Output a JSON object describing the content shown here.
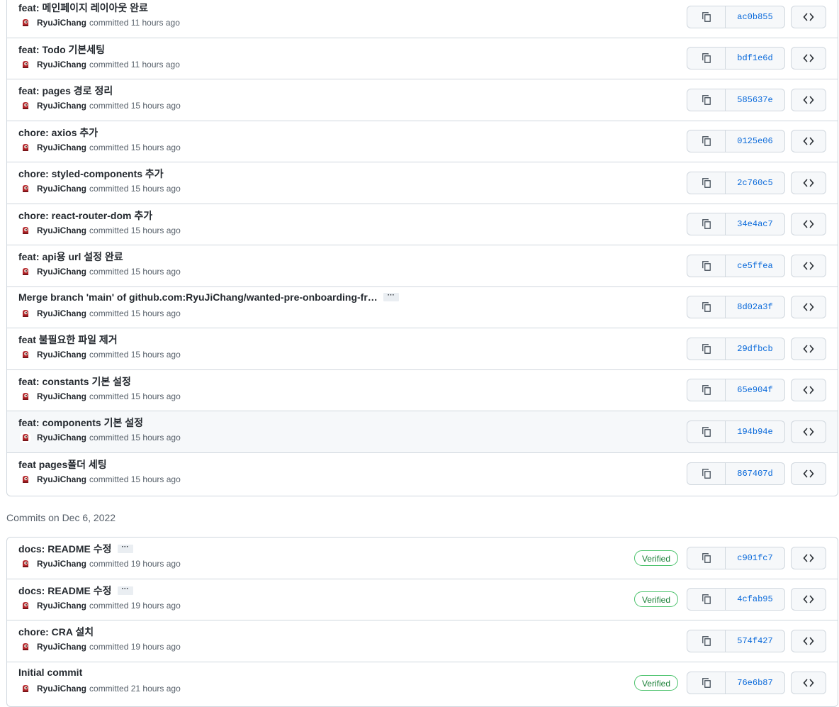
{
  "committed_label": "committed",
  "group_header": "Commits on Dec 6, 2022",
  "verified_label": "Verified",
  "colors": {
    "sha": "#0969da",
    "verified": "#1a7f37",
    "border": "#d0d7de"
  },
  "icons": {
    "copy": "copy-icon",
    "browse": "code-icon",
    "avatar": "avatar"
  },
  "group1": [
    {
      "message": "feat: 메인페이지 레이아웃 완료",
      "author": "RyuJiChang",
      "time": "11 hours ago",
      "sha": "ac0b855",
      "more": false,
      "verified": false
    },
    {
      "message": "feat: Todo 기본세팅",
      "author": "RyuJiChang",
      "time": "11 hours ago",
      "sha": "bdf1e6d",
      "more": false,
      "verified": false
    },
    {
      "message": "feat: pages 경로 정리",
      "author": "RyuJiChang",
      "time": "15 hours ago",
      "sha": "585637e",
      "more": false,
      "verified": false
    },
    {
      "message": "chore: axios 추가",
      "author": "RyuJiChang",
      "time": "15 hours ago",
      "sha": "0125e06",
      "more": false,
      "verified": false
    },
    {
      "message": "chore: styled-components 추가",
      "author": "RyuJiChang",
      "time": "15 hours ago",
      "sha": "2c760c5",
      "more": false,
      "verified": false
    },
    {
      "message": "chore: react-router-dom 추가",
      "author": "RyuJiChang",
      "time": "15 hours ago",
      "sha": "34e4ac7",
      "more": false,
      "verified": false
    },
    {
      "message": "feat: api용 url 설정 완료",
      "author": "RyuJiChang",
      "time": "15 hours ago",
      "sha": "ce5ffea",
      "more": false,
      "verified": false
    },
    {
      "message": "Merge branch 'main' of github.com:RyuJiChang/wanted-pre-onboarding-fr…",
      "author": "RyuJiChang",
      "time": "15 hours ago",
      "sha": "8d02a3f",
      "more": true,
      "verified": false
    },
    {
      "message": "feat 불필요한 파일 제거",
      "author": "RyuJiChang",
      "time": "15 hours ago",
      "sha": "29dfbcb",
      "more": false,
      "verified": false
    },
    {
      "message": "feat: constants 기본 설정",
      "author": "RyuJiChang",
      "time": "15 hours ago",
      "sha": "65e904f",
      "more": false,
      "verified": false
    },
    {
      "message": "feat: components 기본 설정",
      "author": "RyuJiChang",
      "time": "15 hours ago",
      "sha": "194b94e",
      "more": false,
      "verified": false,
      "hover": true
    },
    {
      "message": "feat pages폴더 세팅",
      "author": "RyuJiChang",
      "time": "15 hours ago",
      "sha": "867407d",
      "more": false,
      "verified": false
    }
  ],
  "group2": [
    {
      "message": "docs: README 수정",
      "author": "RyuJiChang",
      "time": "19 hours ago",
      "sha": "c901fc7",
      "more": true,
      "verified": true
    },
    {
      "message": "docs: README 수정",
      "author": "RyuJiChang",
      "time": "19 hours ago",
      "sha": "4cfab95",
      "more": true,
      "verified": true
    },
    {
      "message": "chore: CRA 설치",
      "author": "RyuJiChang",
      "time": "19 hours ago",
      "sha": "574f427",
      "more": false,
      "verified": false
    },
    {
      "message": "Initial commit",
      "author": "RyuJiChang",
      "time": "21 hours ago",
      "sha": "76e6b87",
      "more": false,
      "verified": true
    }
  ]
}
